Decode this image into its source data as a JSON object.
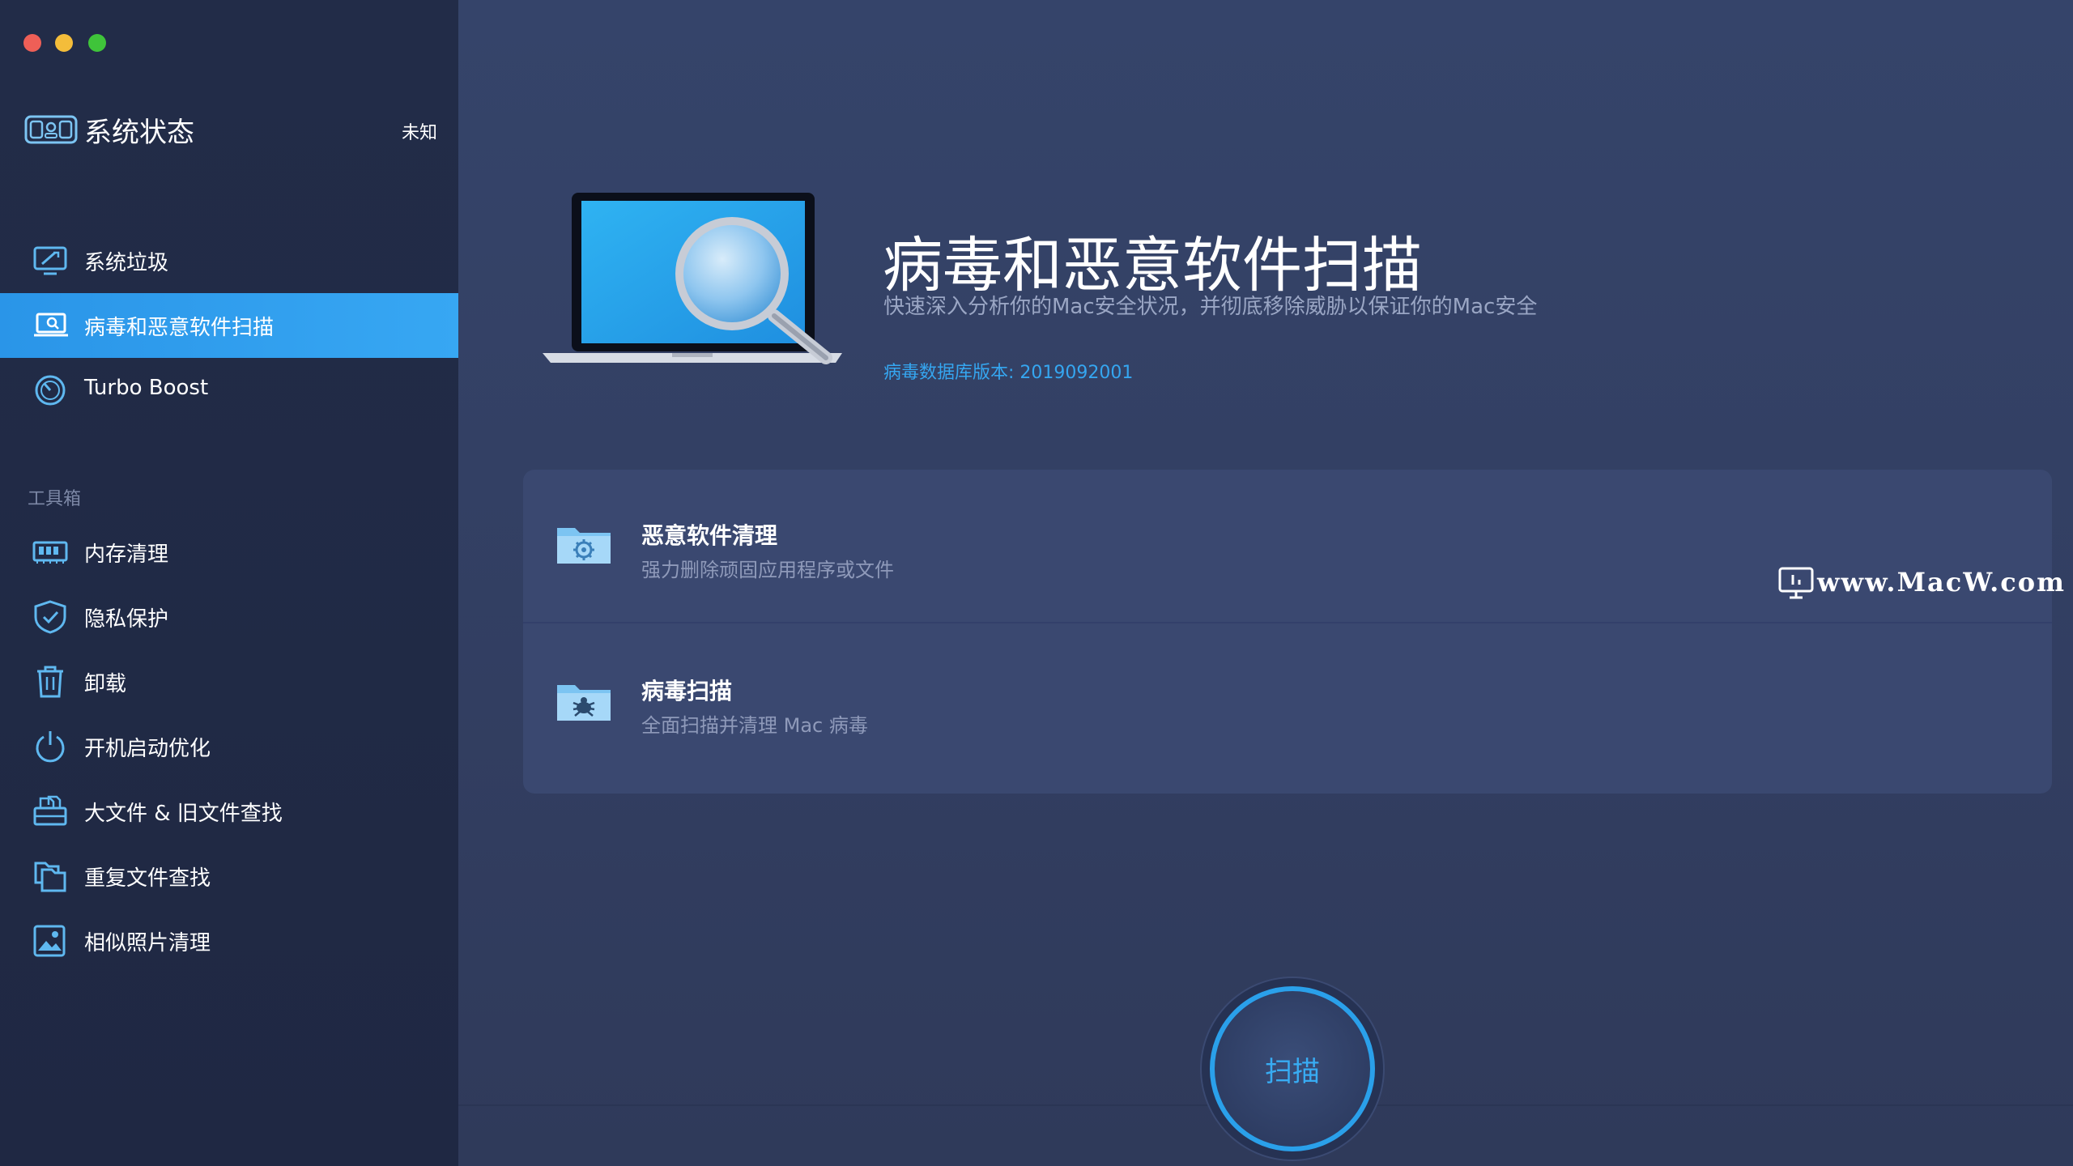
{
  "sidebar": {
    "status": {
      "title": "系统状态",
      "value": "未知"
    },
    "items": [
      {
        "label": "系统垃圾",
        "icon": "monitor-clean-icon"
      },
      {
        "label": "病毒和恶意软件扫描",
        "icon": "laptop-search-icon",
        "active": true
      },
      {
        "label": "Turbo Boost",
        "icon": "speed-gauge-icon"
      }
    ],
    "toolbox_header": "工具箱",
    "tools": [
      {
        "label": "内存清理",
        "icon": "memory-chip-icon"
      },
      {
        "label": "隐私保护",
        "icon": "shield-check-icon"
      },
      {
        "label": "卸载",
        "icon": "trash-icon"
      },
      {
        "label": "开机启动优化",
        "icon": "power-icon"
      },
      {
        "label": "大文件 & 旧文件查找",
        "icon": "file-box-icon"
      },
      {
        "label": "重复文件查找",
        "icon": "duplicate-folder-icon"
      },
      {
        "label": "相似照片清理",
        "icon": "photo-icon"
      }
    ]
  },
  "main": {
    "title": "病毒和恶意软件扫描",
    "subtitle": "快速深入分析你的Mac安全状况，并彻底移除威胁以保证你的Mac安全",
    "db_version": "病毒数据库版本: 2019092001",
    "cards": [
      {
        "title": "恶意软件清理",
        "desc": "强力删除顽固应用程序或文件",
        "icon": "folder-gear-icon"
      },
      {
        "title": "病毒扫描",
        "desc": "全面扫描并清理 Mac 病毒",
        "icon": "folder-bug-icon"
      }
    ],
    "scan_label": "扫描"
  },
  "watermark": {
    "text": "www.MacW.com"
  },
  "colors": {
    "accent": "#2a95e8",
    "sidebar_bg": "#222c48",
    "main_bg": "#35446a",
    "link": "#35a6f0"
  }
}
